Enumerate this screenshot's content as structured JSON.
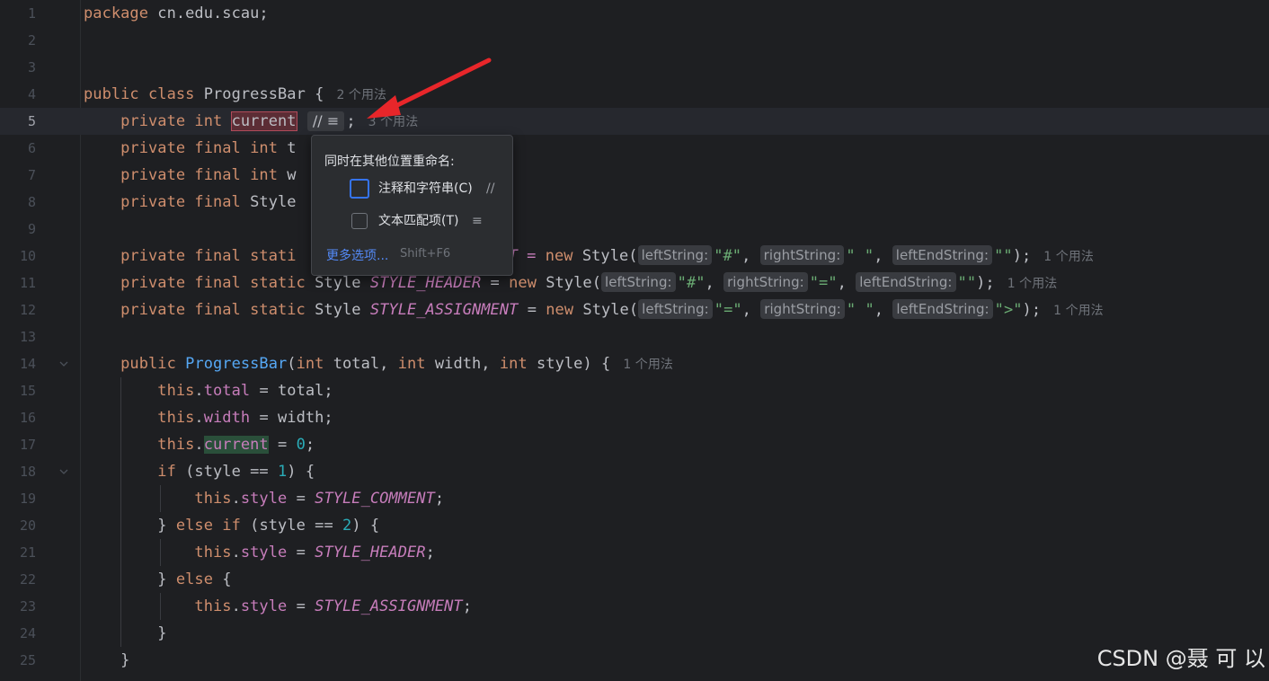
{
  "editor": {
    "line_numbers": [
      "1",
      "2",
      "3",
      "4",
      "5",
      "6",
      "7",
      "8",
      "9",
      "10",
      "11",
      "12",
      "13",
      "14",
      "15",
      "16",
      "17",
      "18",
      "19",
      "20",
      "21",
      "22",
      "23",
      "24",
      "25"
    ],
    "current_line": "5",
    "l1": {
      "kw": "package",
      "rest": " cn.edu.scau;"
    },
    "l4": {
      "kw1": "public",
      "kw2": "class",
      "name": " ProgressBar {",
      "usage": "2 个用法"
    },
    "l5": {
      "kw": "private int ",
      "var": "current",
      "semi": ";",
      "usage": "3 个用法"
    },
    "l6": {
      "kw": "private final int ",
      "rest": "t"
    },
    "l7": {
      "kw": "private final int ",
      "rest": "w"
    },
    "l8": {
      "kw": "private final ",
      "rest": "Style"
    },
    "l10": {
      "kw": "private final stati",
      "after": "T = ",
      "new": "new",
      "cls": " Style(",
      "h1": "leftString:",
      "s1": "\"#\"",
      "h2": "rightString:",
      "s2": "\" \"",
      "h3": "leftEndString:",
      "s3": "\"\"",
      "end": ");",
      "usage": "1 个用法"
    },
    "l11": {
      "kw": "private final static",
      "cls": " Style ",
      "name": "STYLE_HEADER",
      "eq": " = ",
      "new": "new",
      "cls2": " Style(",
      "h1": "leftString:",
      "s1": "\"#\"",
      "h2": "rightString:",
      "s2": "\"=\"",
      "h3": "leftEndString:",
      "s3": "\"\"",
      "end": ");",
      "usage": "1 个用法"
    },
    "l12": {
      "kw": "private final static",
      "cls": " Style ",
      "name": "STYLE_ASSIGNMENT",
      "eq": " = ",
      "new": "new",
      "cls2": " Style(",
      "h1": "leftString:",
      "s1": "\"=\"",
      "h2": "rightString:",
      "s2": "\" \"",
      "h3": "leftEndString:",
      "s3": "\">\"",
      "end": ");",
      "usage": "1 个用法"
    },
    "l14": {
      "kw": "public",
      "fn": "ProgressBar",
      "p1": "(",
      "int1": "int",
      "a1": " total, ",
      "int2": "int",
      "a2": " width, ",
      "int3": "int",
      "a3": " style) {",
      "usage": "1 个用法"
    },
    "l15": {
      "this": "this",
      "dot": ".",
      "fld": "total",
      "rest": " = total;"
    },
    "l16": {
      "this": "this",
      "dot": ".",
      "fld": "width",
      "rest": " = width;"
    },
    "l17": {
      "this": "this",
      "dot": ".",
      "fld": "current",
      "eq": " = ",
      "num": "0",
      "semi": ";"
    },
    "l18": {
      "kw": "if",
      "a": " (style == ",
      "num": "1",
      "b": ") {"
    },
    "l19": {
      "this": "this",
      "dot": ".",
      "fld": "style",
      "eq": " = ",
      "sfld": "STYLE_COMMENT",
      "semi": ";"
    },
    "l20": {
      "a": "} ",
      "kw1": "else",
      "kw2": "if",
      "b": " (style == ",
      "num": "2",
      "c": ") {"
    },
    "l21": {
      "this": "this",
      "dot": ".",
      "fld": "style",
      "eq": " = ",
      "sfld": "STYLE_HEADER",
      "semi": ";"
    },
    "l22": {
      "a": "} ",
      "kw": "else",
      "b": " {"
    },
    "l23": {
      "this": "this",
      "dot": ".",
      "fld": "style",
      "eq": " = ",
      "sfld": "STYLE_ASSIGNMENT",
      "semi": ";"
    },
    "l24": {
      "a": "}"
    },
    "l25": {
      "a": "}"
    }
  },
  "rename_controls": {
    "comments_icon": "//",
    "text_icon": "≡"
  },
  "popup": {
    "title": "同时在其他位置重命名:",
    "options": [
      {
        "label": "注释和字符串(C)",
        "icon": "//",
        "checked": false,
        "focused": true
      },
      {
        "label": "文本匹配项(T)",
        "icon": "≡",
        "checked": false,
        "focused": false
      }
    ],
    "more_label": "更多选项...",
    "more_shortcut": "Shift+F6"
  },
  "watermark": "CSDN @聂 可 以",
  "colors": {
    "arrow": "#e8262a",
    "accent": "#3574f0"
  }
}
